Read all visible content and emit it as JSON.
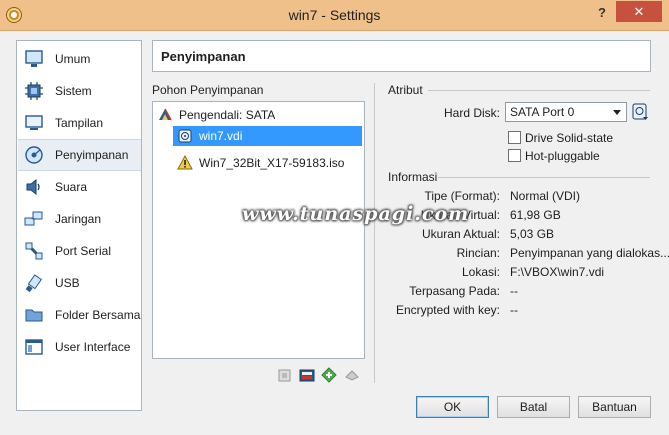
{
  "window": {
    "title": "win7 - Settings",
    "help_label": "?",
    "close_label": "✕"
  },
  "nav": {
    "items": [
      {
        "label": "Umum",
        "icon": "monitor-icon"
      },
      {
        "label": "Sistem",
        "icon": "chip-icon"
      },
      {
        "label": "Tampilan",
        "icon": "display-icon"
      },
      {
        "label": "Penyimpanan",
        "icon": "storage-icon",
        "active": true
      },
      {
        "label": "Suara",
        "icon": "speaker-icon"
      },
      {
        "label": "Jaringan",
        "icon": "network-icon"
      },
      {
        "label": "Port Serial",
        "icon": "serial-port-icon"
      },
      {
        "label": "USB",
        "icon": "usb-icon"
      },
      {
        "label": "Folder Bersama",
        "icon": "folder-icon"
      },
      {
        "label": "User Interface",
        "icon": "window-icon"
      }
    ]
  },
  "page": {
    "title": "Penyimpanan"
  },
  "tree": {
    "header": "Pohon Penyimpanan",
    "controller": "Pengendali: SATA",
    "items": [
      {
        "label": "win7.vdi",
        "selected": true,
        "icon": "hard-disk-icon"
      },
      {
        "label": "Win7_32Bit_X17-59183.iso",
        "selected": false,
        "icon": "warning-icon"
      }
    ]
  },
  "attributes": {
    "header": "Atribut",
    "hard_disk_label": "Hard Disk:",
    "hard_disk_value": "SATA Port 0",
    "ssd_label": "Drive Solid-state",
    "hotplug_label": "Hot-pluggable"
  },
  "info": {
    "header": "Informasi",
    "rows": [
      {
        "label": "Tipe (Format):",
        "value": "Normal (VDI)"
      },
      {
        "label": "Ukuran Virtual:",
        "value": "61,98 GB"
      },
      {
        "label": "Ukuran Aktual:",
        "value": "5,03 GB"
      },
      {
        "label": "Rincian:",
        "value": "Penyimpanan yang dialokas..."
      },
      {
        "label": "Lokasi:",
        "value": "F:\\VBOX\\win7.vdi"
      },
      {
        "label": "Terpasang Pada:",
        "value": "--"
      },
      {
        "label": "Encrypted with key:",
        "value": "--"
      }
    ]
  },
  "buttons": {
    "ok": "OK",
    "cancel": "Batal",
    "help": "Bantuan"
  },
  "watermark": "www.tunaspagi.com",
  "colors": {
    "titlebar": "#f0c08a",
    "close": "#c7503f",
    "selection": "#3399ff"
  }
}
